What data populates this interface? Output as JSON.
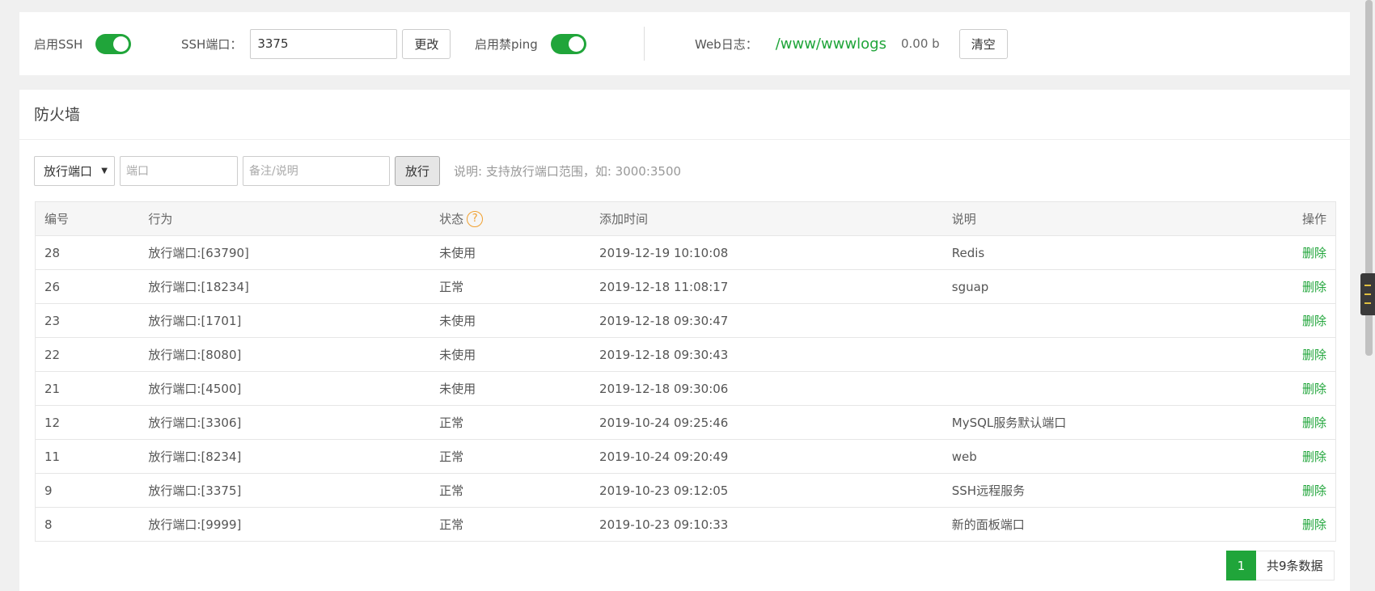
{
  "settings": {
    "ssh_label": "启用SSH",
    "ssh_enabled": true,
    "ssh_port_label": "SSH端口：",
    "ssh_port_value": "3375",
    "change_button": "更改",
    "noping_label": "启用禁ping",
    "noping_enabled": true,
    "weblog_label": "Web日志：",
    "weblog_path": "/www/wwwlogs",
    "weblog_size": "0.00 b",
    "clear_button": "清空"
  },
  "firewall": {
    "title": "防火墙",
    "type_select": "放行端口",
    "port_placeholder": "端口",
    "note_placeholder": "备注/说明",
    "release_button": "放行",
    "hint": "说明: 支持放行端口范围，如: 3000:3500",
    "columns": {
      "id": "编号",
      "action": "行为",
      "status": "状态",
      "time": "添加时间",
      "note": "说明",
      "op": "操作"
    },
    "status_help_icon": "question-circle-icon",
    "rows": [
      {
        "id": "28",
        "action": "放行端口:[63790]",
        "status": "未使用",
        "time": "2019-12-19 10:10:08",
        "note": "Redis",
        "op": "删除"
      },
      {
        "id": "26",
        "action": "放行端口:[18234]",
        "status": "正常",
        "time": "2019-12-18 11:08:17",
        "note": "sguap",
        "op": "删除"
      },
      {
        "id": "23",
        "action": "放行端口:[1701]",
        "status": "未使用",
        "time": "2019-12-18 09:30:47",
        "note": "",
        "op": "删除"
      },
      {
        "id": "22",
        "action": "放行端口:[8080]",
        "status": "未使用",
        "time": "2019-12-18 09:30:43",
        "note": "",
        "op": "删除"
      },
      {
        "id": "21",
        "action": "放行端口:[4500]",
        "status": "未使用",
        "time": "2019-12-18 09:30:06",
        "note": "",
        "op": "删除"
      },
      {
        "id": "12",
        "action": "放行端口:[3306]",
        "status": "正常",
        "time": "2019-10-24 09:25:46",
        "note": "MySQL服务默认端口",
        "op": "删除"
      },
      {
        "id": "11",
        "action": "放行端口:[8234]",
        "status": "正常",
        "time": "2019-10-24 09:20:49",
        "note": "web",
        "op": "删除"
      },
      {
        "id": "9",
        "action": "放行端口:[3375]",
        "status": "正常",
        "time": "2019-10-23 09:12:05",
        "note": "SSH远程服务",
        "op": "删除"
      },
      {
        "id": "8",
        "action": "放行端口:[9999]",
        "status": "正常",
        "time": "2019-10-23 09:10:33",
        "note": "新的面板端口",
        "op": "删除"
      }
    ],
    "pagination": {
      "current_page": "1",
      "total_text": "共9条数据"
    }
  },
  "colors": {
    "accent": "#20a53a",
    "help_icon": "#f0a030"
  }
}
